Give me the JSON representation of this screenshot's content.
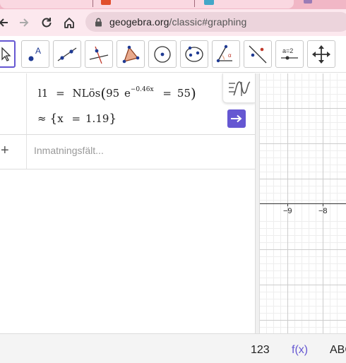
{
  "browser": {
    "url_host": "geogebra.org",
    "url_path": "/classic#graphing"
  },
  "toolbar": {
    "input_bar_tool_label": "a=2"
  },
  "algebra": {
    "expression": {
      "name": "l1",
      "eq": "=",
      "func": "NLös",
      "coef": "95",
      "base": "e",
      "exponent": "−0.46x",
      "rhs_eq": "=",
      "rhs": "55"
    },
    "result": {
      "approx": "≈",
      "open": "{",
      "var": "x",
      "eq": "=",
      "value": "1.19",
      "close": "}"
    },
    "input_placeholder": "Inmatningsfält..."
  },
  "graphics": {
    "x_tick_labels": [
      "−9",
      "−8"
    ]
  },
  "keyboard_bar": {
    "numbers": "123",
    "functions": "f(x)",
    "letters": "ABC"
  },
  "colors": {
    "accent": "#6557d2",
    "tab_active": "#fad8e1",
    "function_blue": "#6557d2"
  }
}
